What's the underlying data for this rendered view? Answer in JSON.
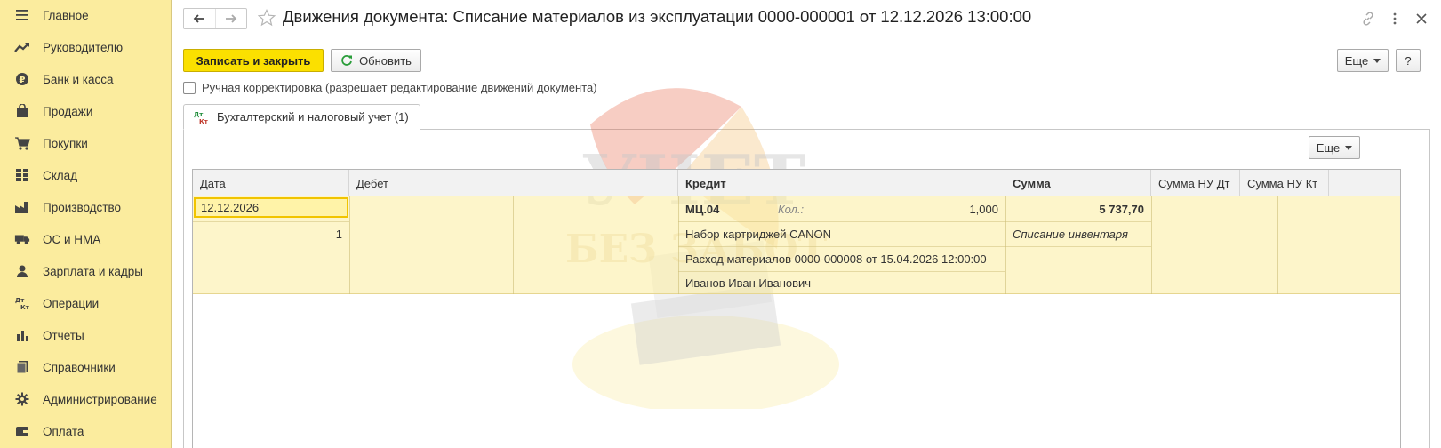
{
  "sidebar": {
    "items": [
      {
        "label": "Главное",
        "icon": "menu-lines-icon"
      },
      {
        "label": "Руководителю",
        "icon": "trend-up-icon"
      },
      {
        "label": "Банк и касса",
        "icon": "coin-icon"
      },
      {
        "label": "Продажи",
        "icon": "shopping-bag-icon"
      },
      {
        "label": "Покупки",
        "icon": "cart-icon"
      },
      {
        "label": "Склад",
        "icon": "warehouse-icon"
      },
      {
        "label": "Производство",
        "icon": "factory-icon"
      },
      {
        "label": "ОС и НМА",
        "icon": "truck-icon"
      },
      {
        "label": "Зарплата и кадры",
        "icon": "person-icon"
      },
      {
        "label": "Операции",
        "icon": "dt-kt-icon"
      },
      {
        "label": "Отчеты",
        "icon": "bar-chart-icon"
      },
      {
        "label": "Справочники",
        "icon": "books-icon"
      },
      {
        "label": "Администрирование",
        "icon": "gear-icon"
      },
      {
        "label": "Оплата",
        "icon": "wallet-icon"
      }
    ]
  },
  "header": {
    "title": "Движения документа: Списание материалов из эксплуатации 0000-000001 от 12.12.2026 13:00:00"
  },
  "toolbar": {
    "save_close_label": "Записать и закрыть",
    "refresh_label": "Обновить",
    "more_label": "Еще",
    "help_label": "?"
  },
  "manual_edit": {
    "label": "Ручная корректировка (разрешает редактирование движений документа)",
    "checked": false
  },
  "tabs": [
    {
      "label": "Бухгалтерский и налоговый учет (1)",
      "icon_text_top": "Дт",
      "icon_text_bottom": "Кт"
    }
  ],
  "panel": {
    "more_label": "Еще"
  },
  "table": {
    "columns": [
      "Дата",
      "Дебет",
      "Кредит",
      "Сумма",
      "Сумма НУ Дт",
      "Сумма НУ Кт"
    ],
    "row": {
      "date": "12.12.2026",
      "line_number": "1",
      "credit_account": "МЦ.04",
      "qty_label": "Кол.:",
      "qty_value": "1,000",
      "amount": "5 737,70",
      "credit_subconto1": "Набор картриджей CANON",
      "amount_description": "Списание инвентаря",
      "credit_subconto2": "Расход материалов 0000-000008 от 15.04.2026 12:00:00",
      "credit_subconto3": "Иванов Иван Иванович"
    }
  },
  "watermark": {
    "line1": "УЧЕТ",
    "line2": "БЕЗ ЗАБОТ"
  }
}
